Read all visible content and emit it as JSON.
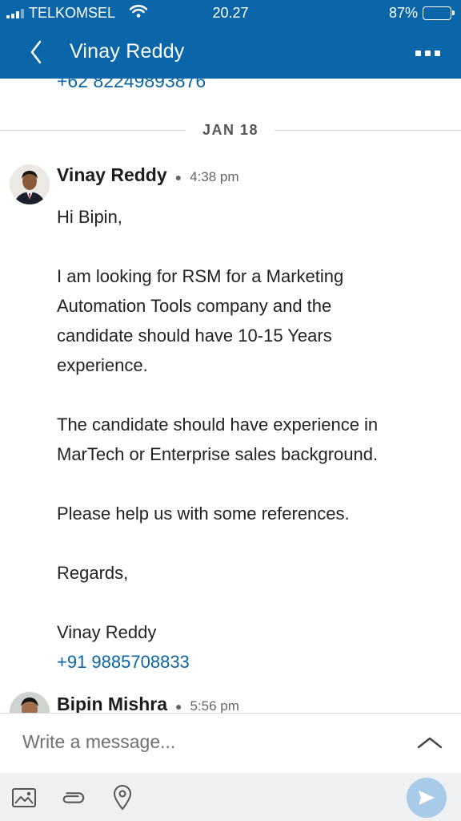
{
  "status_bar": {
    "carrier": "TELKOMSEL",
    "time": "20.27",
    "battery": "87%",
    "icons": [
      "signal-icon",
      "wifi-icon",
      "battery-icon"
    ]
  },
  "header": {
    "title": "Vinay Reddy",
    "back_icon": "chevron-left-icon",
    "menu_icon": "more-horizontal-icon",
    "background": "#0a66a8"
  },
  "thread": {
    "previous_phone": "+62 82249893876",
    "date_separator": "JAN 18",
    "messages": [
      {
        "sender": "Vinay Reddy",
        "time": "4:38 pm",
        "lines": [
          "Hi Bipin,",
          "",
          "I am looking for RSM for a Marketing",
          "Automation Tools company and the",
          "candidate should have 10-15 Years",
          "experience.",
          "",
          "The candidate should have experience in",
          "MarTech or Enterprise sales background.",
          "",
          "Please help us with some references.",
          "",
          "Regards,",
          "",
          "Vinay Reddy"
        ],
        "phone": "+91 9885708833"
      },
      {
        "sender": "Bipin Mishra",
        "time": "5:56 pm"
      }
    ]
  },
  "composer": {
    "placeholder": "Write a message...",
    "expand_icon": "chevron-up-icon"
  },
  "toolbar": {
    "icons": [
      "image-icon",
      "attachment-icon",
      "location-pin-icon",
      "send-icon"
    ]
  },
  "colors": {
    "accent": "#0a66a8",
    "link": "#0a66a8",
    "send_button": "#a7cbe8",
    "toolbar_bg": "#eef0f2"
  }
}
